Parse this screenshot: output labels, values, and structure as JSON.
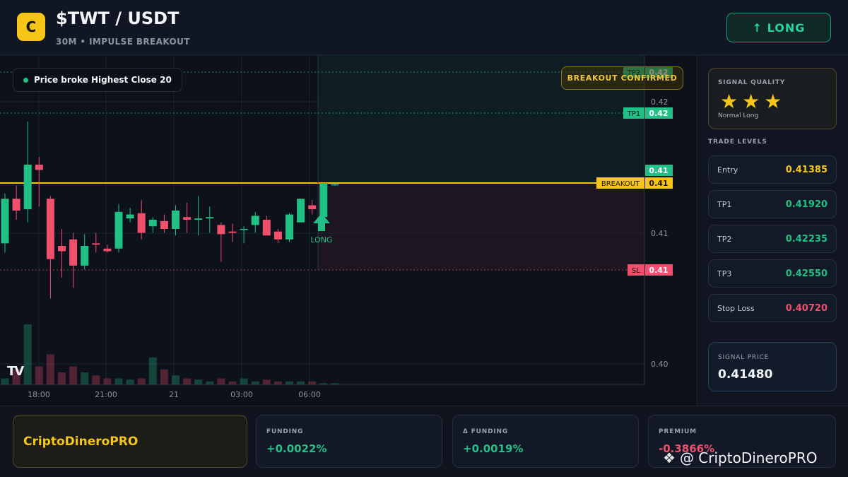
{
  "header": {
    "logo_letter": "C",
    "pair": "$TWT / USDT",
    "subtitle": "30M • IMPULSE BREAKOUT",
    "long_button": "↑ LONG"
  },
  "chart": {
    "legend": "Price broke Highest Close 20",
    "badge": "BREAKOUT CONFIRMED",
    "long_marker": "LONG",
    "x_labels": [
      "18:00",
      "21:00",
      "21",
      "03:00",
      "06:00"
    ],
    "y_labels": [
      "0.42",
      "0.41",
      "0.40"
    ],
    "levels": [
      {
        "tag": "TP2",
        "value": "0.42"
      },
      {
        "tag": "TP1",
        "value": "0.42"
      },
      {
        "tag": "",
        "value": "0.41"
      },
      {
        "tag": "BREAKOUT",
        "value": "0.41"
      },
      {
        "tag": "SL",
        "value": "0.41"
      }
    ]
  },
  "chart_data": {
    "type": "candlestick",
    "title": "",
    "xlabel": "",
    "ylabel": "",
    "x": [
      "16:30",
      "17:00",
      "17:30",
      "18:00",
      "18:30",
      "19:00",
      "19:30",
      "20:00",
      "20:30",
      "21:00",
      "21:30",
      "22:00",
      "22:30",
      "23:00",
      "23:30",
      "00:00",
      "00:30",
      "01:00",
      "01:30",
      "02:00",
      "02:30",
      "03:00",
      "03:30",
      "04:00",
      "04:30",
      "05:00",
      "05:30",
      "06:00",
      "06:30",
      "07:00"
    ],
    "ohlc": [
      [
        0.4092,
        0.413,
        0.4085,
        0.4126
      ],
      [
        0.4126,
        0.4136,
        0.411,
        0.4117
      ],
      [
        0.4118,
        0.4185,
        0.4108,
        0.4152
      ],
      [
        0.4152,
        0.4158,
        0.412,
        0.4148
      ],
      [
        0.4126,
        0.4128,
        0.405,
        0.408
      ],
      [
        0.409,
        0.4103,
        0.4066,
        0.4086
      ],
      [
        0.4095,
        0.41,
        0.4058,
        0.4075
      ],
      [
        0.4075,
        0.4099,
        0.4072,
        0.409
      ],
      [
        0.4092,
        0.41,
        0.4085,
        0.4091
      ],
      [
        0.4088,
        0.4091,
        0.4085,
        0.4086
      ],
      [
        0.4088,
        0.4122,
        0.4085,
        0.4116
      ],
      [
        0.4111,
        0.4119,
        0.4108,
        0.4114
      ],
      [
        0.4115,
        0.4125,
        0.4095,
        0.41
      ],
      [
        0.4105,
        0.4112,
        0.41,
        0.411
      ],
      [
        0.4109,
        0.4114,
        0.41,
        0.4103
      ],
      [
        0.4103,
        0.4121,
        0.4098,
        0.4117
      ],
      [
        0.4112,
        0.4123,
        0.41,
        0.411
      ],
      [
        0.411,
        0.4128,
        0.4098,
        0.4111
      ],
      [
        0.4111,
        0.412,
        0.41,
        0.4112
      ],
      [
        0.4106,
        0.4108,
        0.4078,
        0.4099
      ],
      [
        0.4101,
        0.4107,
        0.4093,
        0.41
      ],
      [
        0.4103,
        0.4105,
        0.4092,
        0.4103
      ],
      [
        0.4106,
        0.4116,
        0.41,
        0.4113
      ],
      [
        0.411,
        0.4113,
        0.41,
        0.4098
      ],
      [
        0.4101,
        0.4103,
        0.4092,
        0.4095
      ],
      [
        0.4095,
        0.4115,
        0.4093,
        0.4114
      ],
      [
        0.4108,
        0.4126,
        0.4108,
        0.4126
      ],
      [
        0.4121,
        0.4125,
        0.4114,
        0.4118
      ],
      [
        0.4112,
        0.4138,
        0.411,
        0.4138
      ],
      [
        0.4137,
        0.4138,
        0.4136,
        0.4137
      ]
    ],
    "volume_relative": [
      0.1,
      0.25,
      1.0,
      0.3,
      0.5,
      0.2,
      0.3,
      0.2,
      0.15,
      0.1,
      0.1,
      0.08,
      0.1,
      0.45,
      0.25,
      0.15,
      0.1,
      0.08,
      0.05,
      0.1,
      0.05,
      0.1,
      0.05,
      0.08,
      0.05,
      0.05,
      0.05,
      0.05,
      0.02,
      0.02
    ],
    "ylim": [
      0.3985,
      0.4225
    ],
    "levels": {
      "tp2": 0.42235,
      "tp1": 0.4192,
      "breakout": 0.41385,
      "sl": 0.4072,
      "last": 0.4137
    },
    "grid": true
  },
  "sidebar": {
    "quality_title": "SIGNAL QUALITY",
    "stars": "★★★",
    "star_count": 3,
    "quality_note": "Normal Long",
    "levels_title": "TRADE LEVELS",
    "levels": [
      {
        "label": "Entry",
        "value": "0.41385",
        "color": "#f5c518"
      },
      {
        "label": "TP1",
        "value": "0.41920",
        "color": "#21c087"
      },
      {
        "label": "TP2",
        "value": "0.42235",
        "color": "#21c087"
      },
      {
        "label": "TP3",
        "value": "0.42550",
        "color": "#21c087"
      },
      {
        "label": "Stop Loss",
        "value": "0.40720",
        "color": "#f0506e"
      }
    ],
    "signal_price_title": "SIGNAL PRICE",
    "signal_price": "0.41480"
  },
  "footer": {
    "brand": "CriptoDineroPRO",
    "funding_title": "FUNDING",
    "funding_value": "+0.0022%",
    "dfunding_title": "Δ FUNDING",
    "dfunding_value": "+0.0019%",
    "premium_title": "PREMIUM",
    "premium_value": "-0.3866%",
    "watermark": "@ CriptoDineroPRO"
  },
  "colors": {
    "bull": "#21c087",
    "bear": "#f0506e",
    "accent": "#f5c518"
  }
}
